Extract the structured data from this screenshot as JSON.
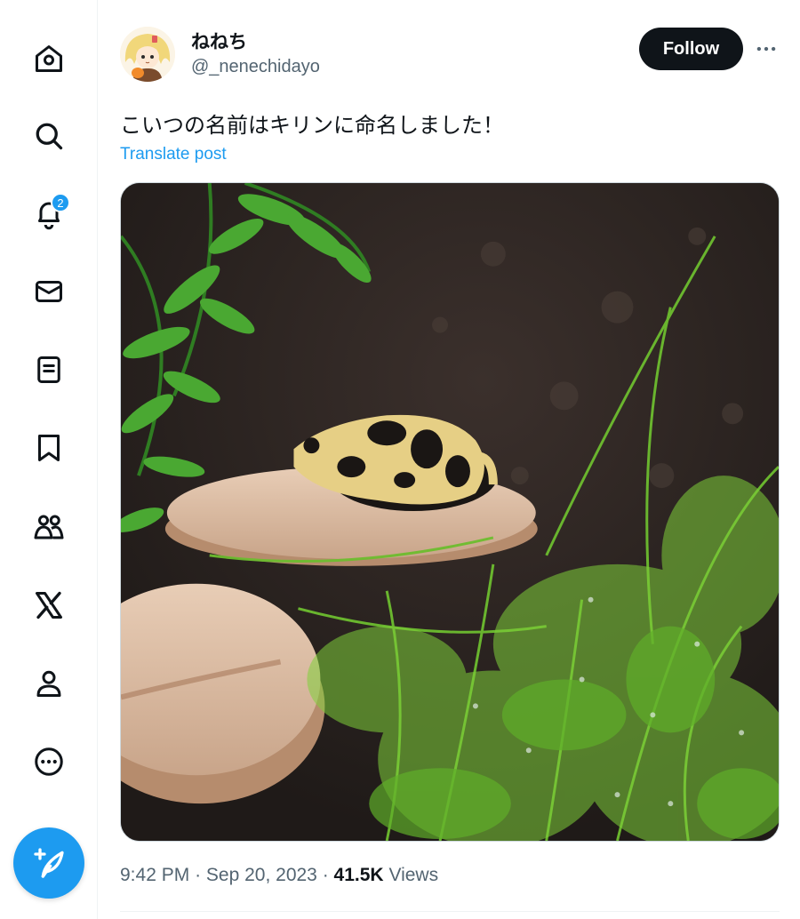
{
  "sidebar": {
    "items": [
      {
        "name": "home",
        "icon": "home-icon"
      },
      {
        "name": "explore",
        "icon": "search-icon"
      },
      {
        "name": "notifications",
        "icon": "bell-icon",
        "badge": "2"
      },
      {
        "name": "messages",
        "icon": "mail-icon"
      },
      {
        "name": "lists",
        "icon": "list-icon"
      },
      {
        "name": "bookmarks",
        "icon": "bookmark-icon"
      },
      {
        "name": "communities",
        "icon": "communities-icon"
      },
      {
        "name": "premium",
        "icon": "x-logo-icon"
      },
      {
        "name": "profile",
        "icon": "person-icon"
      },
      {
        "name": "more",
        "icon": "more-circle-icon"
      }
    ],
    "compose_icon": "compose-post-icon"
  },
  "post": {
    "author": {
      "display_name": "ねねち",
      "handle": "@_nenechidayo"
    },
    "follow_label": "Follow",
    "more_icon": "ellipsis-icon",
    "text": "こいつの名前はキリンに命名しました！",
    "translate_label": "Translate post",
    "time": "9:42 PM",
    "separator": "·",
    "date": "Sep 20, 2023",
    "views_count": "41.5K",
    "views_label": "Views"
  },
  "colors": {
    "accent": "#1d9bf0",
    "text_primary": "#0f1419",
    "text_secondary": "#536471",
    "follow_bg": "#0f1419"
  }
}
